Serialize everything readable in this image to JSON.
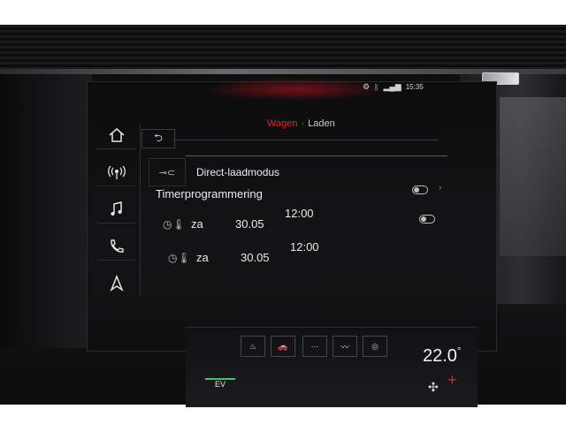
{
  "status_bar": {
    "time": "15:35"
  },
  "breadcrumb": {
    "parent": "Wagen",
    "separator": "·",
    "current": "Laden"
  },
  "sidebar": {
    "items": [
      {
        "name": "home-icon"
      },
      {
        "name": "radio-icon"
      },
      {
        "name": "music-icon"
      },
      {
        "name": "phone-icon"
      },
      {
        "name": "navigation-icon"
      }
    ]
  },
  "direct": {
    "label": "Direct-laadmodus"
  },
  "timer": {
    "title": "Timerprogrammering",
    "rows": [
      {
        "day": "za",
        "date": "30.05",
        "time": "12:00"
      },
      {
        "day": "za",
        "date": "30.05",
        "time": "12:00"
      }
    ]
  },
  "climate": {
    "mode": "EV",
    "temperature": "22.0"
  },
  "colors": {
    "accent": "#e0232f",
    "ev_green": "#3ec46b"
  }
}
